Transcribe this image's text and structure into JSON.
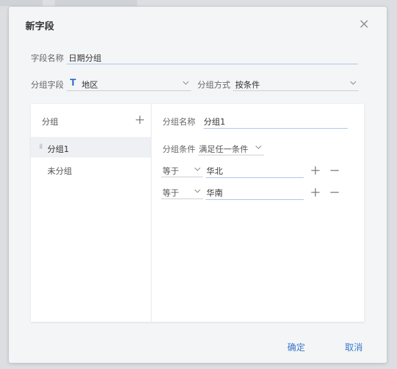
{
  "dialog": {
    "title": "新字段",
    "close_icon": "close-icon"
  },
  "field_name": {
    "label": "字段名称",
    "value": "日期分组"
  },
  "group_field": {
    "label": "分组字段",
    "type_icon": "T",
    "value": "地区"
  },
  "group_method": {
    "label": "分组方式",
    "value": "按条件"
  },
  "groups_pane": {
    "header": "分组",
    "items": [
      {
        "label": "分组1",
        "selected": true
      },
      {
        "label": "未分组",
        "selected": false
      }
    ]
  },
  "group_detail": {
    "name_label": "分组名称",
    "name_value": "分组1",
    "condition_label": "分组条件",
    "condition_value": "满足任一条件",
    "conditions": [
      {
        "operator": "等于",
        "value": "华北"
      },
      {
        "operator": "等于",
        "value": "华南"
      }
    ]
  },
  "footer": {
    "confirm_label": "确定",
    "cancel_label": "取消"
  },
  "colors": {
    "accent": "#3a78c9",
    "underline_active": "#a9c4e8"
  }
}
